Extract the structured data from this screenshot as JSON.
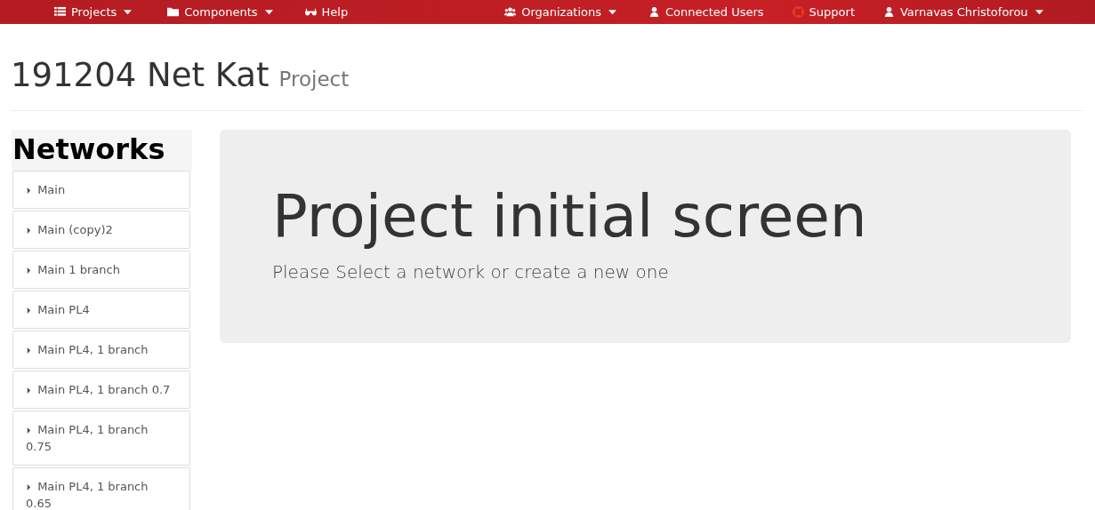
{
  "navbar": {
    "left": [
      {
        "label": "Projects",
        "dropdown": true
      },
      {
        "label": "Components",
        "dropdown": true
      },
      {
        "label": "Help",
        "dropdown": false
      }
    ],
    "right": [
      {
        "label": "Organizations",
        "dropdown": true
      },
      {
        "label": "Connected Users",
        "dropdown": false
      },
      {
        "label": "Support",
        "dropdown": false
      },
      {
        "label": "Varnavas Christoforou",
        "dropdown": true
      }
    ]
  },
  "header": {
    "title": "191204 Net Kat",
    "subtitle": "Project"
  },
  "sidebar": {
    "title": "Networks",
    "items": [
      {
        "label": "Main"
      },
      {
        "label": "Main (copy)2"
      },
      {
        "label": "Main 1 branch"
      },
      {
        "label": "Main PL4"
      },
      {
        "label": "Main PL4, 1 branch"
      },
      {
        "label": "Main PL4, 1 branch 0.7"
      },
      {
        "label": "Main PL4, 1 branch 0.75"
      },
      {
        "label": "Main PL4, 1 branch 0.65"
      }
    ]
  },
  "jumbotron": {
    "heading": "Project initial screen",
    "text": "Please Select a network or create a new one"
  }
}
